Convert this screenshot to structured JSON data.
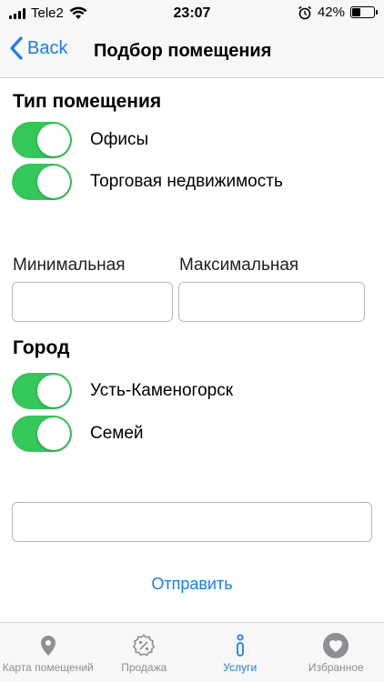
{
  "status_bar": {
    "carrier": "Tele2",
    "time": "23:07",
    "battery_percent": "42%",
    "battery_level": 0.42
  },
  "nav": {
    "back_label": "Back",
    "title": "Подбор помещения"
  },
  "room_type": {
    "title": "Тип помещения",
    "options": [
      {
        "label": "Офисы",
        "on": true
      },
      {
        "label": "Торговая недвижимость",
        "on": true
      }
    ]
  },
  "price": {
    "min_label": "Минимальная",
    "max_label": "Максимальная",
    "min_value": "",
    "max_value": ""
  },
  "city": {
    "title": "Город",
    "options": [
      {
        "label": "Усть-Каменогорск",
        "on": true
      },
      {
        "label": "Семей",
        "on": true
      }
    ]
  },
  "extra_field_value": "",
  "submit_label": "Отправить",
  "tabs": [
    {
      "label": "Карта помещений",
      "icon": "location-pin-icon",
      "active": false
    },
    {
      "label": "Продажа",
      "icon": "percent-badge-icon",
      "active": false
    },
    {
      "label": "Услуги",
      "icon": "info-icon",
      "active": true
    },
    {
      "label": "Избранное",
      "icon": "heart-icon",
      "active": false
    }
  ],
  "colors": {
    "accent": "#1a7cf6",
    "toggle_on": "#34c759",
    "tab_inactive": "#8e8e93"
  }
}
